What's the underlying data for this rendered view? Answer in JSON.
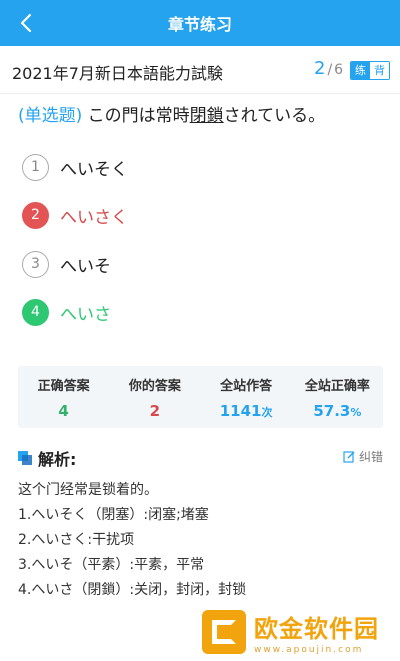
{
  "header": {
    "title": "章节练习"
  },
  "exam": {
    "title": "2021年7月新日本語能力試験"
  },
  "counter": {
    "current": "2",
    "separator": "/",
    "total": "6"
  },
  "mode": {
    "practice": "练",
    "memorize": "背"
  },
  "question": {
    "type": "(单选题)",
    "before": " この門は常時",
    "underlined": "閉鎖",
    "after": "されている。"
  },
  "options": [
    {
      "num": "1",
      "text": "へいそく",
      "state": "normal"
    },
    {
      "num": "2",
      "text": "へいさく",
      "state": "wrong"
    },
    {
      "num": "3",
      "text": "へいそ",
      "state": "normal"
    },
    {
      "num": "4",
      "text": "へいさ",
      "state": "correct"
    }
  ],
  "stats": {
    "correct_label": "正确答案",
    "correct_value": "4",
    "yours_label": "你的答案",
    "yours_value": "2",
    "total_label": "全站作答",
    "total_value": "1141",
    "total_unit": "次",
    "rate_label": "全站正确率",
    "rate_value": "57.3",
    "rate_unit": "%"
  },
  "analysis": {
    "title": "解析:",
    "report": "纠错",
    "lines": [
      "这个门经常是锁着的。",
      "1.へいそく（閉塞）:闭塞;堵塞",
      "2.へいさく:干扰项",
      "3.へいそ（平素）:平素，平常",
      "4.へいさ（閉鎖）:关闭，封闭，封锁"
    ]
  },
  "watermark": {
    "name": "欧金软件园",
    "url": "www.apoujin.com"
  },
  "colors": {
    "accent": "#25a3ef",
    "correct": "#2ec772",
    "wrong": "#e35454"
  }
}
